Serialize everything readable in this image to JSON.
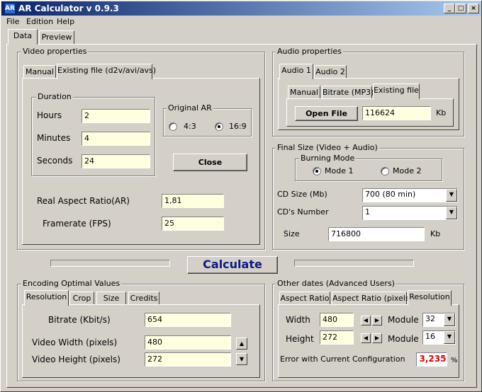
{
  "window": {
    "title": "AR Calculator v 0.9.3",
    "icon_text": "AR",
    "min": "_",
    "max": "□",
    "close": "×"
  },
  "menu": [
    "File",
    "Edition",
    "Help"
  ],
  "main_tabs": [
    "Data",
    "Preview"
  ],
  "video": {
    "group": "Video properties",
    "tabs": [
      "Manual",
      "Existing file (d2v/avi/avs)"
    ],
    "duration": {
      "label": "Duration",
      "hours_label": "Hours",
      "hours": "2",
      "minutes_label": "Minutes",
      "minutes": "4",
      "seconds_label": "Seconds",
      "seconds": "24"
    },
    "original_ar": {
      "label": "Original AR",
      "opt1": "4:3",
      "opt2": "16:9"
    },
    "close_btn": "Close",
    "real_ar_label": "Real Aspect Ratio(AR)",
    "real_ar": "1,81",
    "framerate_label": "Framerate (FPS)",
    "framerate": "25"
  },
  "audio": {
    "group": "Audio properties",
    "tabs": [
      "Audio 1",
      "Audio 2"
    ],
    "subtabs": [
      "Manual",
      "Bitrate (MP3)",
      "Existing file"
    ],
    "open_btn": "Open File",
    "size": "116624",
    "unit": "Kb"
  },
  "final": {
    "group": "Final Size (Video + Audio)",
    "burning": {
      "label": "Burning Mode",
      "mode1": "Mode 1",
      "mode2": "Mode 2"
    },
    "cd_size_label": "CD Size (Mb)",
    "cd_size": "700 (80 min)",
    "cd_number_label": "CD's Number",
    "cd_number": "1",
    "size_label": "Size",
    "size": "716800",
    "unit": "Kb"
  },
  "calculate": "Calculate",
  "encoding": {
    "group": "Encoding Optimal Values",
    "tabs": [
      "Resolution",
      "Crop",
      "Size",
      "Credits"
    ],
    "bitrate_label": "Bitrate (Kbit/s)",
    "bitrate": "654",
    "width_label": "Video Width (pixels)",
    "width": "480",
    "height_label": "Video Height (pixels)",
    "height": "272"
  },
  "other": {
    "group": "Other dates (Advanced Users)",
    "tabs": [
      "Aspect Ratio",
      "Aspect Ratio (pixels)",
      "Resolution"
    ],
    "width_label": "Width",
    "width": "480",
    "height_label": "Height",
    "height": "272",
    "module_label": "Module",
    "module_w": "32",
    "module_h": "16",
    "error_label": "Error with Current Configuration",
    "error": "3,235",
    "pct": "%"
  },
  "colors": {
    "accent": "#0a246a",
    "field_bg": "#ffffe0",
    "error": "#e00000"
  }
}
